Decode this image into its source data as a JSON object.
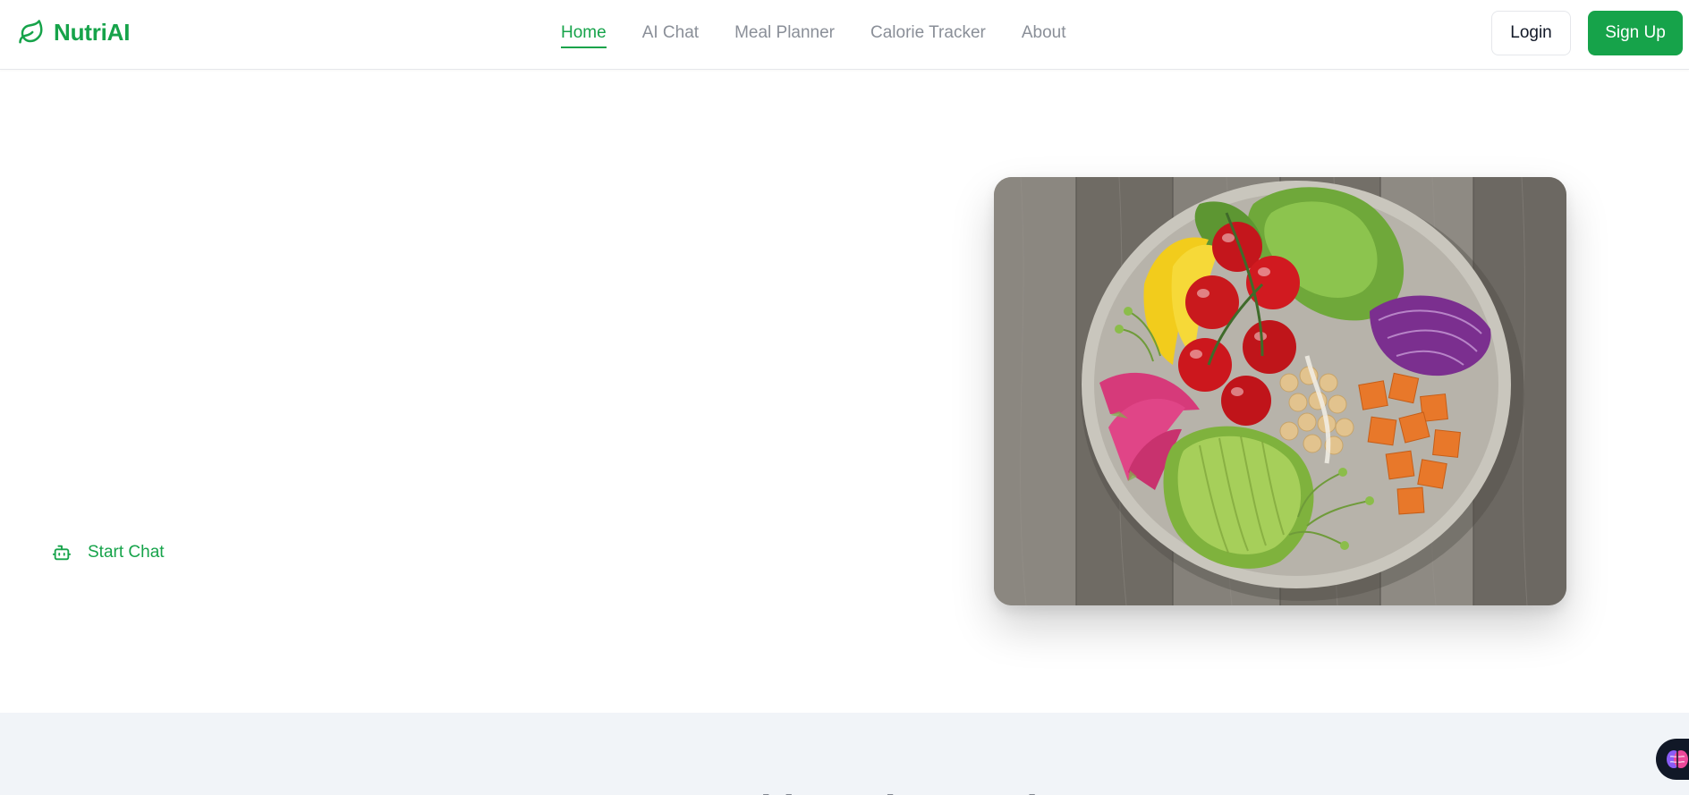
{
  "brand": {
    "name": "NutriAI"
  },
  "nav": {
    "items": [
      {
        "label": "Home",
        "active": true
      },
      {
        "label": "AI Chat",
        "active": false
      },
      {
        "label": "Meal Planner",
        "active": false
      },
      {
        "label": "Calorie Tracker",
        "active": false
      },
      {
        "label": "About",
        "active": false
      }
    ]
  },
  "auth": {
    "login_label": "Login",
    "signup_label": "Sign Up"
  },
  "hero": {
    "cta_label": "Start Chat",
    "cta_icon": "bot-icon",
    "image_subject": "salad-bowl"
  },
  "features": {
    "heading": "Powered by Advanced AI"
  },
  "floating_widget": {
    "icon": "brain-icon"
  },
  "colors": {
    "accent": "#16a34a",
    "nav_inactive": "#8a8f98",
    "section_background": "#f1f4f8",
    "widget_background": "#111827"
  }
}
